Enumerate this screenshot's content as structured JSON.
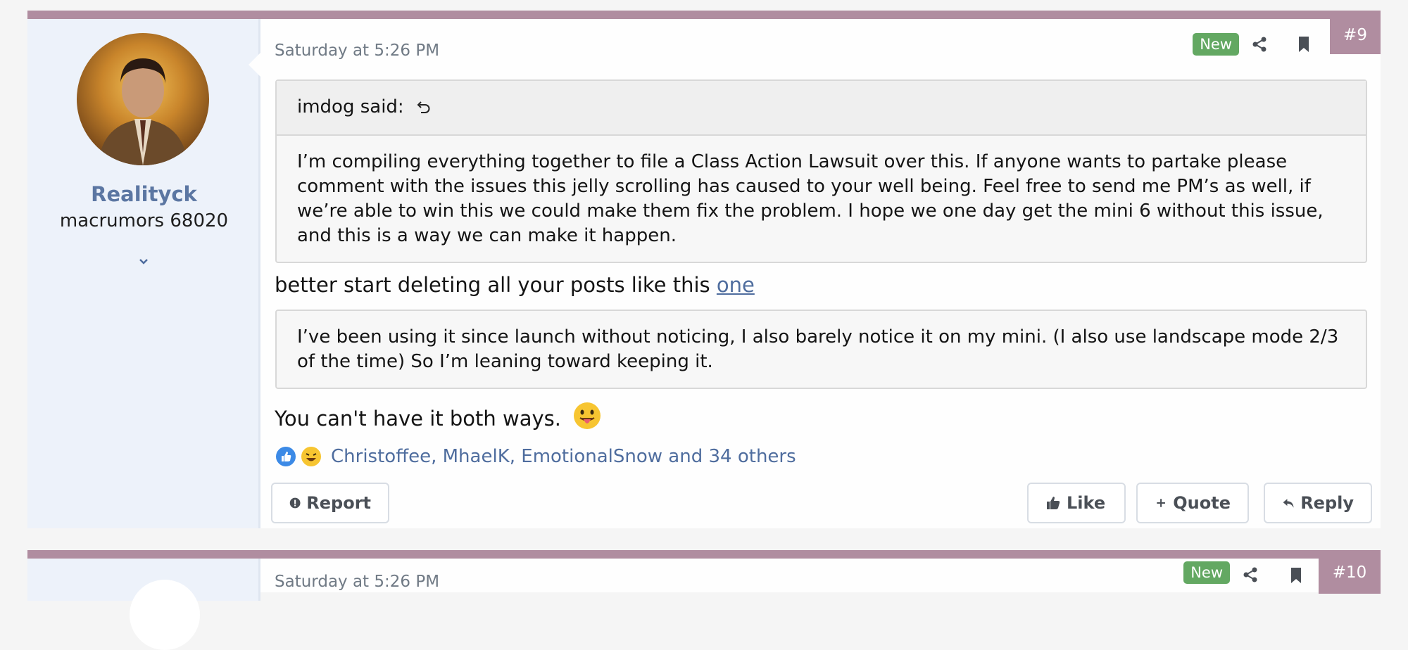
{
  "posts": [
    {
      "date": "Saturday at 5:26 PM",
      "badge": "New",
      "number": "#9",
      "author": {
        "name": "Realityck",
        "title": "macrumors 68020"
      },
      "quote": {
        "author_line": "imdog said:",
        "text": "I’m compiling everything together to file a Class Action Lawsuit over this. If anyone wants to partake please comment with the issues this jelly scrolling has caused to your well being. Feel free to send me PM’s as well, if we’re able to win this we could make them fix the problem. I hope we one day get the mini 6 without this issue, and this is a way we can make it happen."
      },
      "body_line1_prefix": "better start deleting all your posts like this",
      "body_line1_link": "one",
      "quote2_text": "I’ve been using it since launch without noticing, I also barely notice it on my mini. (I also use landscape mode 2/3 of the time) So I’m leaning toward keeping it.",
      "body_line2": "You can't have it both ways.",
      "reactions_text": "Christoffee, MhaelK, EmotionalSnow and 34 others",
      "buttons": {
        "report": "Report",
        "like": "Like",
        "quote": "Quote",
        "reply": "Reply"
      }
    },
    {
      "date": "Saturday at 5:26 PM",
      "badge": "New",
      "number": "#10"
    }
  ],
  "colors": {
    "accent": "#b08da0",
    "link": "#4f6d9e",
    "badge": "#63a862",
    "sidebar": "#edf2fa"
  },
  "icons": [
    "share-icon",
    "bookmark-icon",
    "quote-jump-icon",
    "chevron-down-icon",
    "thumbs-up-icon",
    "plus-icon",
    "reply-icon",
    "report-icon",
    "like-reaction-icon",
    "haha-reaction-icon",
    "tongue-emoji"
  ]
}
